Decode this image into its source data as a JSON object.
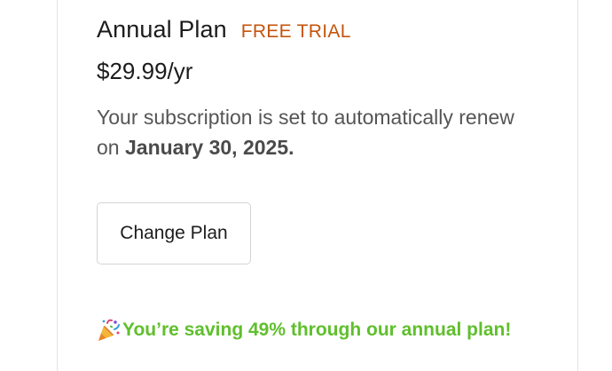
{
  "plan": {
    "name": "Annual Plan",
    "badge": "FREE TRIAL",
    "price": "$29.99/yr"
  },
  "renewal": {
    "text_before": "Your subscription is set to automatically renew on ",
    "date": "January 30, 2025."
  },
  "actions": {
    "change_plan_label": "Change Plan"
  },
  "savings": {
    "icon": "party-popper-icon",
    "text": "You’re saving 49% through our annual plan!"
  },
  "colors": {
    "badge": "#c4550f",
    "savings": "#5fbf2c",
    "text_primary": "#1c1c1c",
    "text_secondary": "#555555"
  }
}
